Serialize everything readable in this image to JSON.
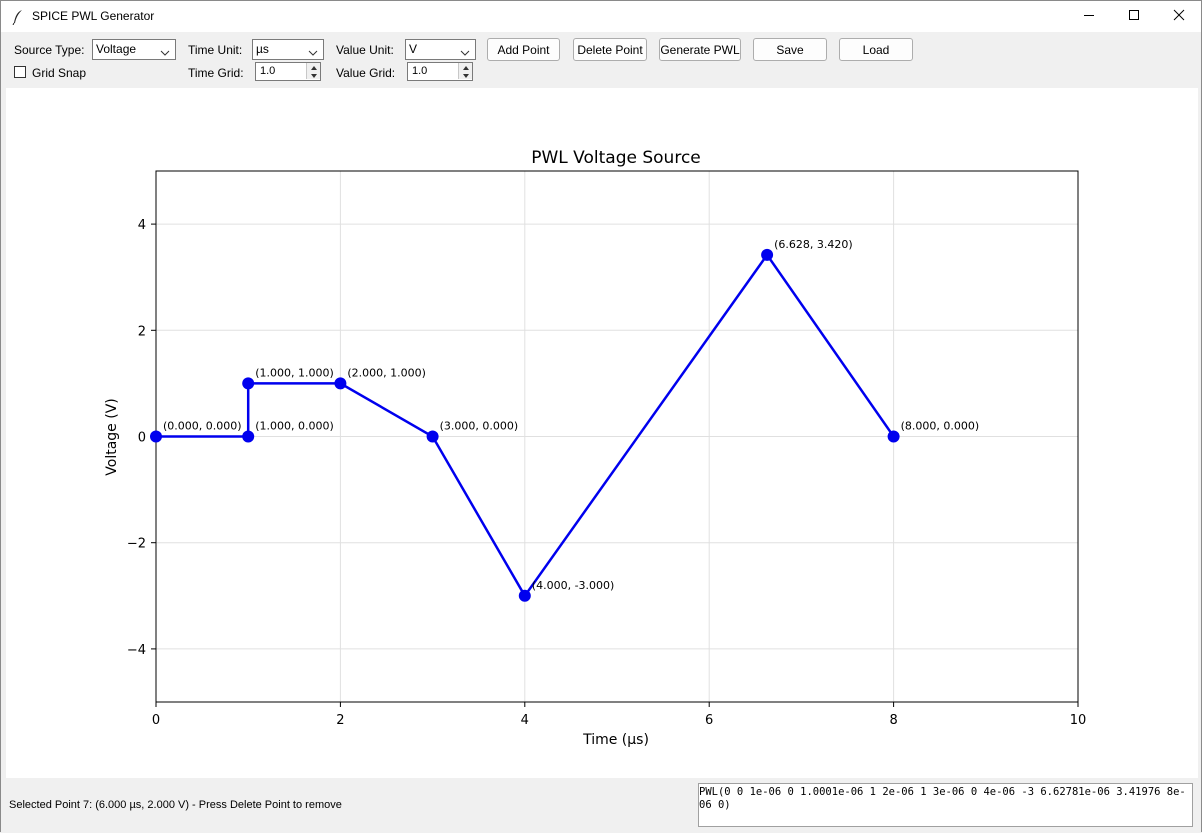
{
  "window": {
    "title": "SPICE PWL Generator"
  },
  "toolbar": {
    "source_type_label": "Source Type:",
    "source_type_value": "Voltage",
    "time_unit_label": "Time Unit:",
    "time_unit_value": "µs",
    "value_unit_label": "Value Unit:",
    "value_unit_value": "V",
    "add_point": "Add Point",
    "delete_point": "Delete Point",
    "generate_pwl": "Generate PWL",
    "save": "Save",
    "load": "Load",
    "grid_snap_label": "Grid Snap",
    "grid_snap_checked": false,
    "time_grid_label": "Time Grid:",
    "time_grid_value": "1.0",
    "value_grid_label": "Value Grid:",
    "value_grid_value": "1.0"
  },
  "status": {
    "text": "Selected Point 7: (6.000 µs, 2.000 V) - Press Delete Point to remove",
    "pwl_output": "PWL(0 0 1e-06 0 1.0001e-06 1 2e-06 1 3e-06 0 4e-06 -3 6.62781e-06 3.41976 8e-06 0)"
  },
  "chart_data": {
    "type": "line",
    "title": "PWL Voltage Source",
    "xlabel": "Time (µs)",
    "ylabel": "Voltage (V)",
    "xlim": [
      0,
      10
    ],
    "ylim": [
      -5,
      5
    ],
    "xticks": [
      0,
      2,
      4,
      6,
      8,
      10
    ],
    "xtick_labels": [
      "0",
      "2",
      "4",
      "6",
      "8",
      "10"
    ],
    "yticks": [
      -4,
      -2,
      0,
      2,
      4
    ],
    "ytick_labels": [
      "−4",
      "−2",
      "0",
      "2",
      "4"
    ],
    "grid": true,
    "color": "#0000ee",
    "series": [
      {
        "x": [
          0,
          1,
          1,
          2,
          3,
          4,
          6.628,
          8
        ],
        "y": [
          0,
          0,
          1,
          1,
          0,
          -3,
          3.42,
          0
        ]
      }
    ],
    "point_labels": [
      "(0.000, 0.000)",
      "(1.000, 0.000)",
      "(1.000, 1.000)",
      "(2.000, 1.000)",
      "(3.000, 0.000)",
      "(4.000, -3.000)",
      "(6.628, 3.420)",
      "(8.000, 0.000)"
    ]
  }
}
